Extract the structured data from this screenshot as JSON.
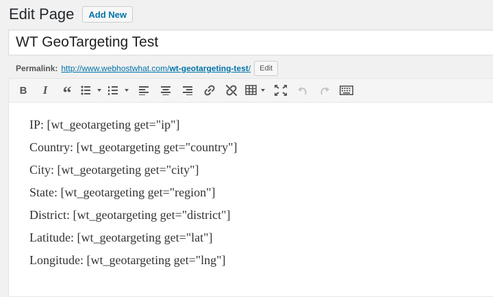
{
  "header": {
    "title": "Edit Page",
    "add_new_label": "Add New"
  },
  "post_title": {
    "value": "WT GeoTargeting Test"
  },
  "permalink": {
    "label": "Permalink:",
    "base_url": "http://www.webhostwhat.com/",
    "slug": "wt-geotargeting-test",
    "trailing": "/",
    "edit_label": "Edit"
  },
  "toolbar": {
    "buttons": [
      {
        "name": "bold-icon",
        "glyph": "B"
      },
      {
        "name": "italic-icon",
        "glyph": "I"
      },
      {
        "name": "blockquote-icon",
        "glyph": "“"
      }
    ]
  },
  "content": {
    "lines": [
      "IP: [wt_geotargeting get=\"ip\"]",
      "Country: [wt_geotargeting get=\"country\"]",
      "City: [wt_geotargeting get=\"city\"]",
      "State: [wt_geotargeting get=\"region\"]",
      "District: [wt_geotargeting get=\"district\"]",
      "Latitude: [wt_geotargeting get=\"lat\"]",
      "Longitude: [wt_geotargeting get=\"lng\"]"
    ]
  }
}
